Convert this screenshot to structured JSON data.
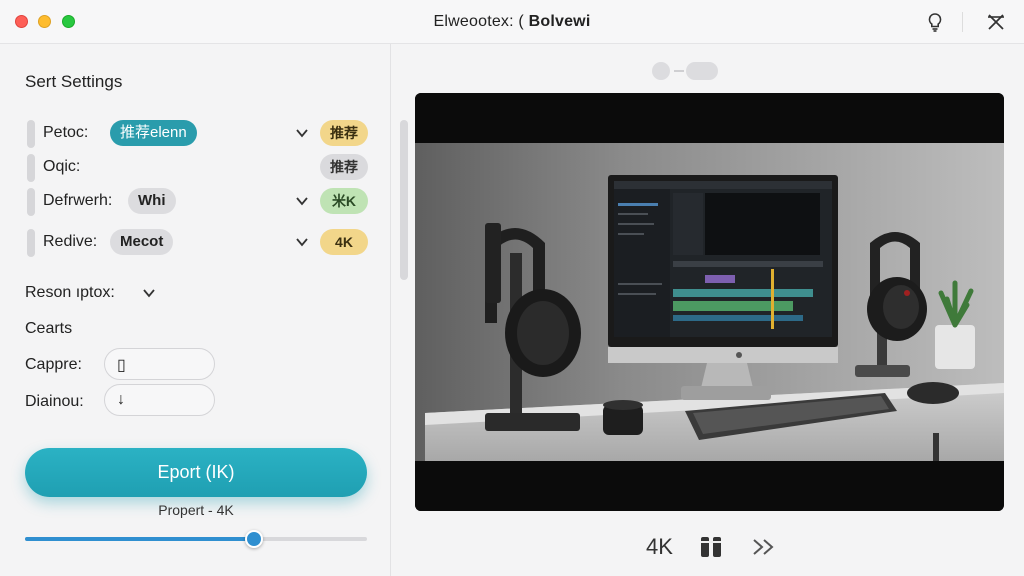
{
  "window": {
    "title_regular": "Elweootex: ( ",
    "title_bold": "Bolvewi",
    "icons": [
      "lightbulb-icon",
      "settings-cross-icon"
    ]
  },
  "sidebar": {
    "section_title": "Sert Settings",
    "rows": [
      {
        "label": "Petoc:",
        "value": "推荐elenn",
        "badge": "推荐",
        "badge_color": "#f2d68a",
        "has_dropdown": true
      },
      {
        "label": "Oqic:",
        "value": "",
        "badge": "推荐",
        "badge_color": "#dadadd",
        "has_dropdown": false
      },
      {
        "label": "Defrwerh:",
        "value": "Whi",
        "badge": "米K",
        "badge_color": "#bfe3b4",
        "has_dropdown": true
      },
      {
        "label": "Redive:",
        "value": "Mecot",
        "badge": "4K",
        "badge_color": "#f2d68a",
        "has_dropdown": true
      }
    ],
    "resolution_label": "Reson ıptox:",
    "section_subtitle": "Cearts",
    "fields": [
      {
        "label": "Cappre:",
        "glyph": "▯"
      },
      {
        "label": "Diainou:",
        "glyph": "↓"
      }
    ],
    "export_button": "Eport (IK)",
    "preset_text": "Propert - 4K",
    "slider_value": 0.67
  },
  "preview": {
    "image_description_icon": "video-preview-image",
    "controls": {
      "quality_label": "4K",
      "pause_icon": "pause-icon",
      "forward_icon": "fast-forward-icon"
    }
  },
  "colors": {
    "accent": "#1f9fb2",
    "slider": "#2f8fd0"
  }
}
